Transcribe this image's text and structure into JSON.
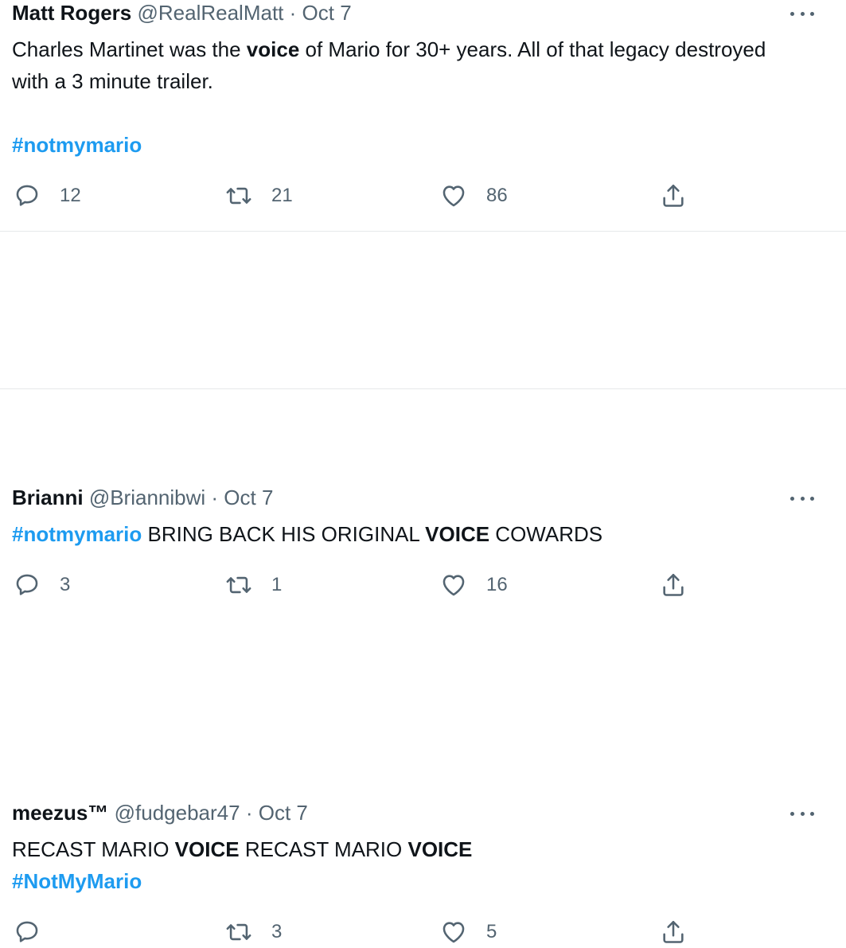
{
  "tweets": [
    {
      "name": "Matt Rogers",
      "handle": "@RealRealMatt",
      "sep": "·",
      "date": "Oct 7",
      "text_parts": [
        "Charles Martinet was the ",
        "voice",
        " of Mario for 30+ years. All of that legacy destroyed with a 3 minute trailer."
      ],
      "hashtag": "#notmymario",
      "replies": "12",
      "retweets": "21",
      "likes": "86"
    },
    {
      "name": "Brianni",
      "handle": "@Briannibwi",
      "sep": "·",
      "date": "Oct 7",
      "hashtag": "#notmymario",
      "text_parts": [
        " BRING BACK HIS ORIGINAL ",
        "VOICE",
        " COWARDS"
      ],
      "replies": "3",
      "retweets": "1",
      "likes": "16"
    },
    {
      "name": "meezus™",
      "handle": "@fudgebar47",
      "sep": "·",
      "date": "Oct 7",
      "text_parts": [
        "RECAST MARIO ",
        "VOICE",
        " RECAST MARIO ",
        "VOICE"
      ],
      "hashtag": "#NotMyMario",
      "replies": "",
      "retweets": "3",
      "likes": "5"
    }
  ],
  "icons": {
    "reply": "reply-icon",
    "retweet": "retweet-icon",
    "like": "heart-icon",
    "share": "share-icon",
    "more": "more-icon"
  },
  "colors": {
    "hashtag": "#1d9bf0",
    "text": "#0f1419",
    "secondary": "#536471",
    "divider": "#e6e9ea"
  }
}
